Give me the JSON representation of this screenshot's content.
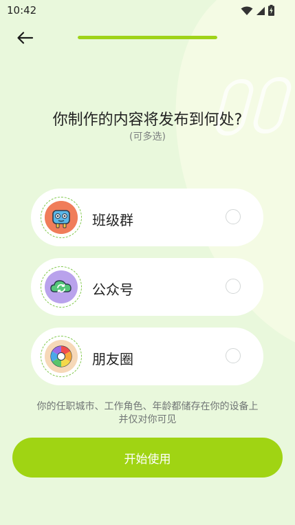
{
  "status_bar": {
    "time": "10:42",
    "icons": [
      "wifi-icon",
      "cellular-signal-icon",
      "battery-charging-icon"
    ]
  },
  "header": {
    "back_icon": "arrow-left-icon",
    "progress_fraction": 1.0
  },
  "question": {
    "title": "你制作的内容将发布到何处?",
    "hint": "(可多选)"
  },
  "options": [
    {
      "label": "班级群",
      "icon": "class-group-robot-icon",
      "selected": false
    },
    {
      "label": "公众号",
      "icon": "official-account-cloud-icon",
      "selected": false
    },
    {
      "label": "朋友圈",
      "icon": "moments-aperture-icon",
      "selected": false
    }
  ],
  "privacy_note": "你的任职城市、工作角色、年龄都储存在你的设备上并仅对你可见",
  "start_button": {
    "label": "开始使用"
  },
  "colors": {
    "background": "#e9f8dc",
    "accent": "#a0d413",
    "card": "#ffffff"
  }
}
